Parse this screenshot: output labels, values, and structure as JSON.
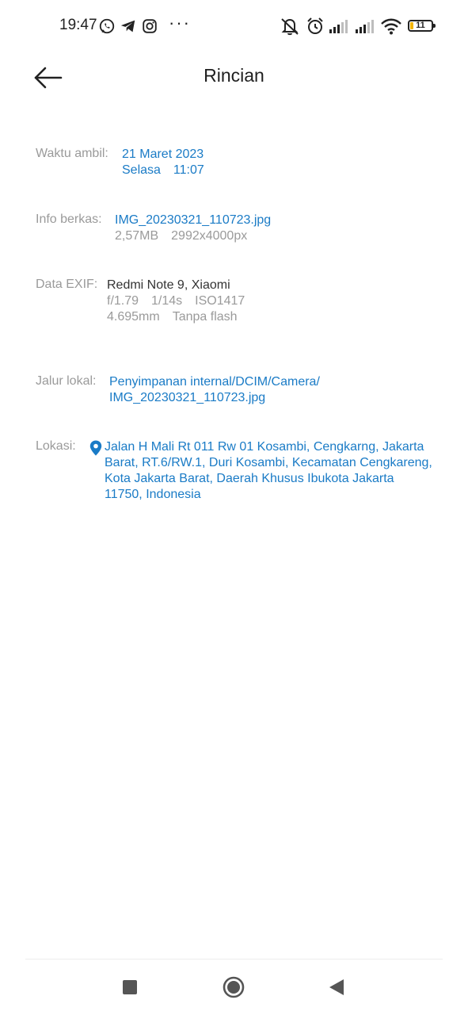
{
  "status_bar": {
    "time": "19:47",
    "notification_icons": [
      "whatsapp-icon",
      "telegram-icon",
      "instagram-icon"
    ],
    "overflow_dots": "···",
    "system_icons": [
      "mute-icon",
      "alarm-icon",
      "signal-icon",
      "signal-icon",
      "wifi-icon"
    ],
    "battery_level": "11"
  },
  "header": {
    "title": "Rincian",
    "back_icon": "arrow-left-icon"
  },
  "details": {
    "taken_time": {
      "label": "Waktu ambil:",
      "date": "21 Maret 2023",
      "day": "Selasa",
      "time": "11:07"
    },
    "file_info": {
      "label": "Info berkas:",
      "filename": "IMG_20230321_110723.jpg",
      "size": "2,57MB",
      "resolution": "2992x4000px"
    },
    "exif": {
      "label": "Data EXIF:",
      "device": "Redmi Note 9, Xiaomi",
      "aperture": "f/1.79",
      "shutter": "1/14s",
      "iso": "ISO1417",
      "focal_length": "4.695mm",
      "flash": "Tanpa flash"
    },
    "local_path": {
      "label": "Jalur lokal:",
      "line1": "Penyimpanan internal/DCIM/Camera/",
      "line2": "IMG_20230321_110723.jpg"
    },
    "location": {
      "label": "Lokasi:",
      "line1": "Jalan H Mali Rt 011 Rw 01 Kosambi, Cengkarng, Jakarta",
      "line2": "Barat, RT.6/RW.1, Duri Kosambi, Kecamatan Cengkareng,",
      "line3": "Kota Jakarta Barat, Daerah Khusus Ibukota Jakarta",
      "line4": "11750, Indonesia"
    }
  },
  "nav_bar": {
    "buttons": [
      "recents-square-icon",
      "home-circle-icon",
      "back-triangle-icon"
    ]
  },
  "colors": {
    "accent": "#1a7bc6",
    "label_gray": "#9a9a9a",
    "text_dark": "#333333",
    "battery_low": "#f2b400"
  }
}
